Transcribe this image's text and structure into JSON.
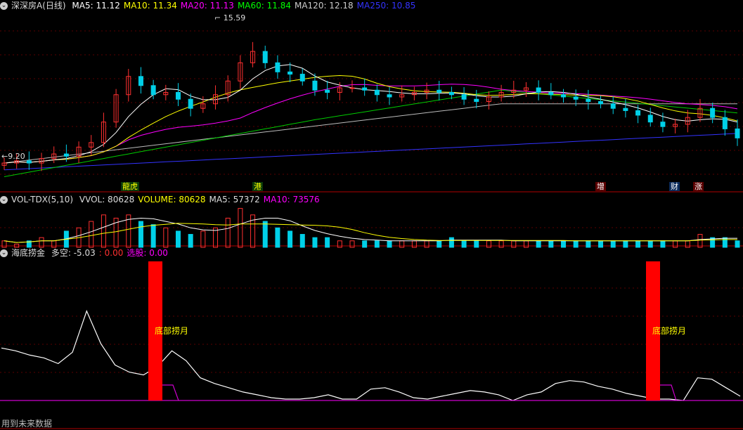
{
  "price_header": {
    "name": "深深房A",
    "period": "(日线)",
    "ma": [
      {
        "label": "MA5: 11.12",
        "color": "#ffffff"
      },
      {
        "label": "MA10: 11.34",
        "color": "#ffff00"
      },
      {
        "label": "MA20: 11.13",
        "color": "#ff00ff"
      },
      {
        "label": "MA60: 11.84",
        "color": "#00ff00"
      },
      {
        "label": "MA120: 12.18",
        "color": "#cccccc"
      },
      {
        "label": "MA250: 10.85",
        "color": "#3333ff"
      }
    ]
  },
  "vol_header": {
    "name": "VOL-TDX(5,10)",
    "items": [
      {
        "label": "VVOL: 80628",
        "color": "#dddddd"
      },
      {
        "label": "VOLUME: 80628",
        "color": "#ffff00"
      },
      {
        "label": "MA5: 57372",
        "color": "#dddddd"
      },
      {
        "label": "MA10: 73576",
        "color": "#ff00ff"
      }
    ]
  },
  "ind_header": {
    "name": "海底捞金",
    "items": [
      {
        "label": "多空: -5.03",
        "color": "#dddddd"
      },
      {
        "label": ": 0.00",
        "color": "#ff3030"
      },
      {
        "label": "选股: 0.00",
        "color": "#ff00ff"
      }
    ]
  },
  "price_annotations": {
    "high": "15.59",
    "low": "9.20"
  },
  "event_tags": [
    {
      "text": "龍虎",
      "color": "#ffff00",
      "bg": "#0a3a0a"
    },
    {
      "text": "港",
      "color": "#ffff00",
      "bg": "#0a3a0a"
    },
    {
      "text": "增",
      "color": "#ffffff",
      "bg": "#5a0000"
    },
    {
      "text": "财",
      "color": "#ffffff",
      "bg": "#0a2a5a"
    },
    {
      "text": "涨",
      "color": "#ffffff",
      "bg": "#5a0000"
    }
  ],
  "bottom_signals": [
    {
      "label": "底部捞月",
      "color": "#ffff00"
    },
    {
      "label": "底部捞月",
      "color": "#ffff00"
    }
  ],
  "footer_text": "用到未来数据",
  "chart_data": [
    {
      "type": "candlestick",
      "ylim": [
        8.8,
        16.2
      ],
      "high_marker": 15.59,
      "low_marker": 9.2,
      "close_trajectory": [
        9.6,
        9.7,
        9.6,
        9.8,
        10.0,
        9.9,
        10.3,
        10.5,
        11.4,
        12.6,
        13.4,
        13.0,
        12.6,
        12.7,
        12.4,
        12.0,
        12.2,
        12.6,
        13.2,
        14.0,
        14.5,
        14.0,
        13.6,
        13.5,
        13.2,
        12.8,
        12.7,
        12.9,
        12.9,
        12.8,
        12.6,
        12.5,
        12.6,
        12.7,
        12.8,
        12.7,
        12.6,
        12.4,
        12.3,
        12.5,
        12.7,
        12.8,
        12.9,
        12.7,
        12.6,
        12.5,
        12.4,
        12.3,
        12.2,
        12.0,
        11.9,
        11.7,
        11.4,
        11.2,
        11.3,
        11.6,
        12.0,
        11.6,
        11.1,
        10.7
      ]
    },
    {
      "type": "bar",
      "series": "volume",
      "values": [
        2,
        1,
        2,
        3,
        2,
        5,
        6,
        8,
        10,
        9,
        10,
        8,
        7,
        6,
        5,
        4,
        5,
        6,
        9,
        12,
        10,
        8,
        6,
        5,
        4,
        3,
        3,
        2,
        2,
        2,
        2,
        2,
        2,
        2,
        2,
        2,
        3,
        2,
        2,
        2,
        2,
        2,
        2,
        2,
        2,
        2,
        2,
        2,
        2,
        2,
        2,
        2,
        2,
        2,
        2,
        2,
        4,
        3,
        3,
        2
      ]
    },
    {
      "type": "line",
      "series": "多空",
      "ylim": [
        0,
        10
      ],
      "values": [
        3.7,
        3.5,
        3.2,
        3.0,
        2.6,
        3.4,
        6.3,
        4.0,
        2.5,
        2.0,
        1.8,
        2.4,
        3.5,
        2.8,
        1.6,
        1.2,
        0.9,
        0.6,
        0.4,
        0.2,
        0.1,
        0.1,
        0.2,
        0.4,
        0.1,
        0.1,
        0.8,
        0.9,
        0.6,
        0.2,
        0.1,
        0.3,
        0.5,
        0.7,
        0.6,
        0.4,
        0.0,
        0.4,
        0.6,
        1.2,
        1.4,
        1.3,
        1.0,
        0.8,
        0.5,
        0.3,
        0.1,
        0.1,
        0.0,
        1.6,
        1.5,
        0.9,
        0.3
      ]
    }
  ]
}
